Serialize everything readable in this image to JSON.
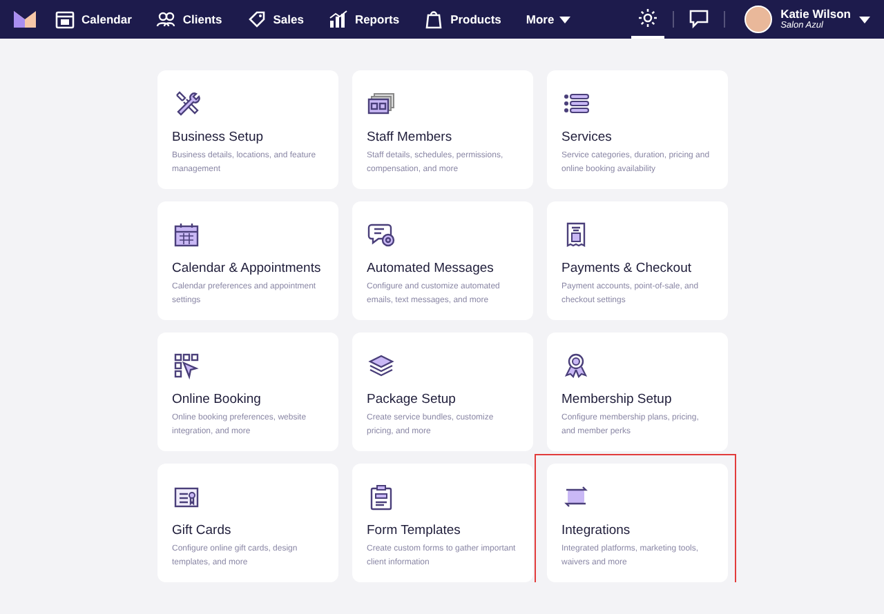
{
  "nav": {
    "items": [
      {
        "label": "Calendar"
      },
      {
        "label": "Clients"
      },
      {
        "label": "Sales"
      },
      {
        "label": "Reports"
      },
      {
        "label": "Products"
      }
    ],
    "more": "More",
    "icon_buttons": [
      {
        "selected": true
      },
      {
        "selected": false
      }
    ],
    "user": {
      "name": "Katie Wilson",
      "subtitle": "Salon Azul"
    }
  },
  "cards": [
    {
      "title": "Business Setup",
      "description": "Business details, locations, and feature management",
      "highlighted": false
    },
    {
      "title": "Staff Members",
      "description": "Staff details, schedules, permissions, compensation, and more",
      "highlighted": false
    },
    {
      "title": "Services",
      "description": "Service categories, duration, pricing and online booking availability",
      "highlighted": false
    },
    {
      "title": "Calendar & Appointments",
      "description": "Calendar preferences and appointment settings",
      "highlighted": false
    },
    {
      "title": "Automated Messages",
      "description": "Configure and customize automated emails, text messages, and more",
      "highlighted": false
    },
    {
      "title": "Payments & Checkout",
      "description": "Payment accounts, point-of-sale, and checkout settings",
      "highlighted": false
    },
    {
      "title": "Online Booking",
      "description": "Online booking preferences, website integration, and more",
      "highlighted": false
    },
    {
      "title": "Package Setup",
      "description": "Create service bundles, customize pricing, and more",
      "highlighted": false
    },
    {
      "title": "Membership Setup",
      "description": "Configure membership plans, pricing, and member perks",
      "highlighted": false
    },
    {
      "title": "Gift Cards",
      "description": "Configure online gift cards, design templates, and more",
      "highlighted": false
    },
    {
      "title": "Form Templates",
      "description": "Create custom forms to gather important client information",
      "highlighted": false
    },
    {
      "title": "Integrations",
      "description": "Integrated platforms, marketing tools, waivers and more",
      "highlighted": true
    }
  ]
}
